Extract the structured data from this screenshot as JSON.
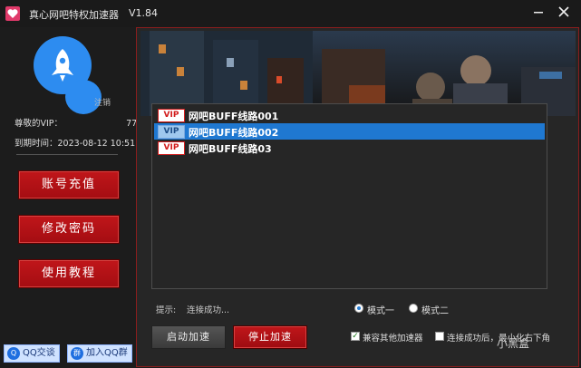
{
  "window": {
    "title": "真心网吧特权加速器",
    "version": "V1.84",
    "minimize_icon": "minimize-icon",
    "close_icon": "close-icon"
  },
  "user": {
    "logout_label": "注销",
    "vip_label": "尊敬的VIP：",
    "vip_value": "77",
    "expire_label": "到期时间：",
    "expire_value": "2023-08-12 10:51"
  },
  "sidebar": {
    "buttons": [
      "账号充值",
      "修改密码",
      "使用教程"
    ]
  },
  "qq": {
    "chat_label": "QQ交谈",
    "group_label": "加入QQ群"
  },
  "lines": {
    "tag": "VIP",
    "items": [
      "网吧BUFF线路001",
      "网吧BUFF线路002",
      "网吧BUFF线路03"
    ],
    "selected_index": 1
  },
  "status": {
    "hint_label": "提示:",
    "hint_text": "连接成功..."
  },
  "modes": {
    "mode1": "模式一",
    "mode2": "模式二",
    "selected": "模式一"
  },
  "actions": {
    "start": "启动加速",
    "stop": "停止加速"
  },
  "options": {
    "compat_label": "兼容其他加速器",
    "compat_checked": true,
    "minimize_label": "连接成功后，最小化右下角",
    "minimize_checked": false
  },
  "watermark": "小黑盒",
  "colors": {
    "accent_red": "#c0161a",
    "selection_blue": "#1f78d1",
    "avatar_blue": "#2d8cf0"
  }
}
